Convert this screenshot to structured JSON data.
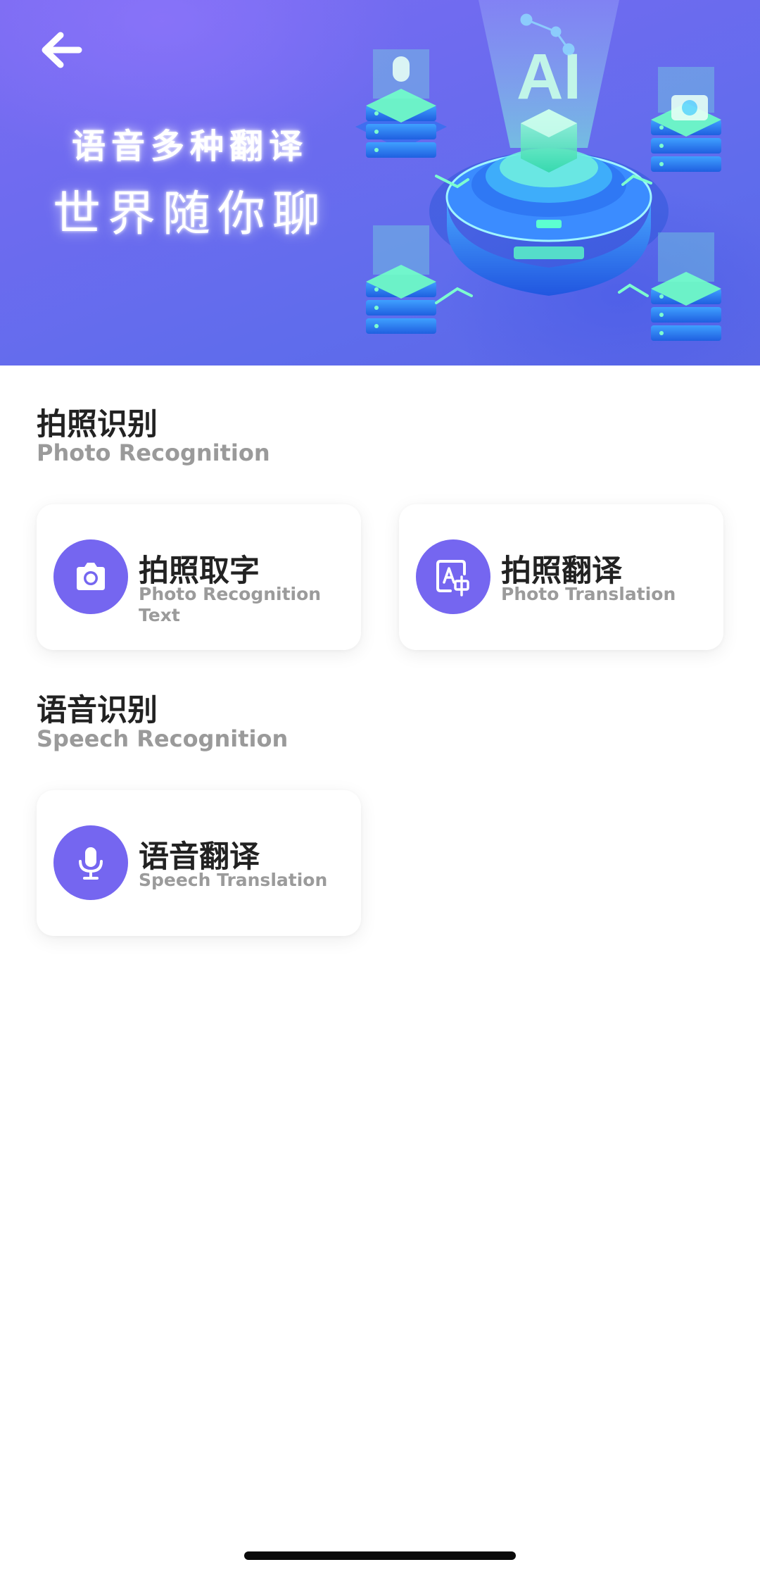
{
  "banner": {
    "slogan_line1": "语音多种翻译",
    "slogan_line2": "世界随你聊",
    "ai_label": "AI",
    "colors": {
      "accent": "#7566f0",
      "banner_bg": "#6a6bef",
      "glow": "#4ee6b8"
    }
  },
  "icons": {
    "back": "arrow-left-icon",
    "camera": "camera-icon",
    "translate": "image-translate-icon",
    "mic": "microphone-icon"
  },
  "sections": [
    {
      "title": "拍照识别",
      "subtitle": "Photo Recognition",
      "cards": [
        {
          "title": "拍照取字",
          "subtitle": "Photo Recognition Text"
        },
        {
          "title": "拍照翻译",
          "subtitle": "Photo Translation"
        }
      ]
    },
    {
      "title": "语音识别",
      "subtitle": "Speech Recognition",
      "cards": [
        {
          "title": "语音翻译",
          "subtitle": "Speech Translation"
        }
      ]
    }
  ]
}
